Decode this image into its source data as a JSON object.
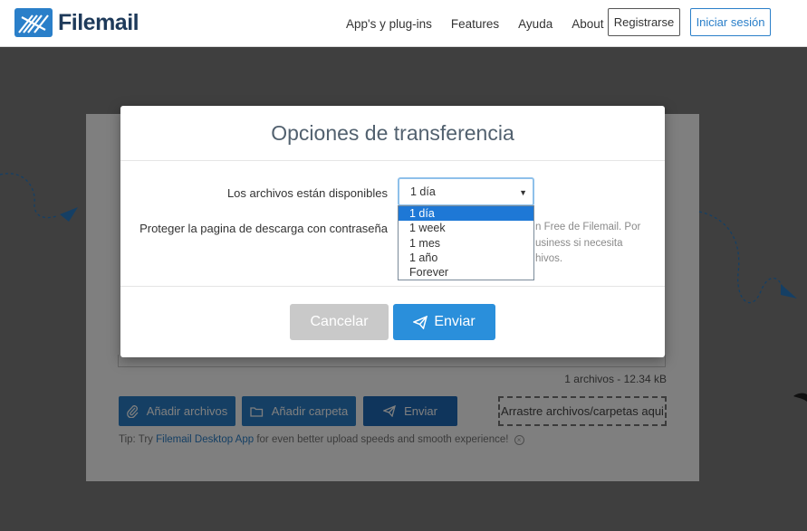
{
  "header": {
    "brand": "Filemail",
    "nav": [
      "App's y plug-ins",
      "Features",
      "Ayuda",
      "About us"
    ],
    "register_label": "Registrarse",
    "login_label": "Iniciar sesión"
  },
  "background": {
    "file_count": "1 archivos - 12.34 kB",
    "add_files_label": "Añadir archivos",
    "add_folder_label": "Añadir carpeta",
    "send_label": "Enviar",
    "drop_zone_label": "Arrastre archivos/carpetas aqui",
    "tip_prefix": "Tip: Try ",
    "tip_link": "Filemail Desktop App",
    "tip_suffix": " for even better upload speeds and smooth experience!"
  },
  "modal": {
    "title": "Opciones de transferencia",
    "availability_label": "Los archivos están disponibles",
    "password_label": "Proteger la pagina de descarga con contraseña",
    "selected_value": "1 día",
    "help_lines": [
      "n Free de Filemail. Por",
      "usiness si necesita",
      "hivos."
    ],
    "cancel_label": "Cancelar",
    "send_label": "Enviar"
  },
  "dropdown": {
    "options": [
      "1 día",
      "1 week",
      "1 mes",
      "1 año",
      "Forever"
    ],
    "selected_index": 0
  },
  "colors": {
    "brand_blue": "#2a7fc9",
    "send_blue": "#2a8fdb",
    "cancel_gray": "#c9c9c9",
    "option_highlight": "#1e78d6"
  }
}
